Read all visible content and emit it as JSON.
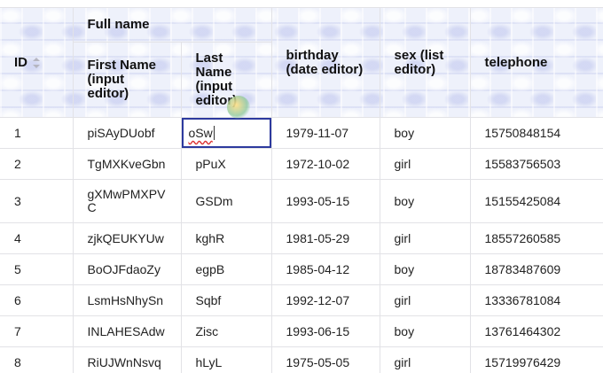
{
  "header": {
    "id_label": "ID",
    "group_label": "Full name",
    "first_name_label": "First Name (input editor)",
    "last_name_label": "Last Name (input editor)",
    "birthday_label": "birthday (date editor)",
    "sex_label": "sex (list editor)",
    "telephone_label": "telephone"
  },
  "editing": {
    "value": "oSw"
  },
  "rows": [
    {
      "id": "1",
      "first": "piSAyDUobf",
      "last": "oSw",
      "birthday": "1979-11-07",
      "sex": "boy",
      "telephone": "15750848154"
    },
    {
      "id": "2",
      "first": "TgMXKveGbn",
      "last": "pPuX",
      "birthday": "1972-10-02",
      "sex": "girl",
      "telephone": "15583756503"
    },
    {
      "id": "3",
      "first": "gXMwPMXPVC",
      "last": "GSDm",
      "birthday": "1993-05-15",
      "sex": "boy",
      "telephone": "15155425084"
    },
    {
      "id": "4",
      "first": "zjkQEUKYUw",
      "last": "kghR",
      "birthday": "1981-05-29",
      "sex": "girl",
      "telephone": "18557260585"
    },
    {
      "id": "5",
      "first": "BoOJFdaoZy",
      "last": "egpB",
      "birthday": "1985-04-12",
      "sex": "boy",
      "telephone": "18783487609"
    },
    {
      "id": "6",
      "first": "LsmHsNhySn",
      "last": "Sqbf",
      "birthday": "1992-12-07",
      "sex": "girl",
      "telephone": "13336781084"
    },
    {
      "id": "7",
      "first": "INLAHESAdw",
      "last": "Zisc",
      "birthday": "1993-06-15",
      "sex": "boy",
      "telephone": "13761464302"
    },
    {
      "id": "8",
      "first": "RiUJWnNsvq",
      "last": "hLyL",
      "birthday": "1975-05-05",
      "sex": "girl",
      "telephone": "15719976429"
    }
  ]
}
